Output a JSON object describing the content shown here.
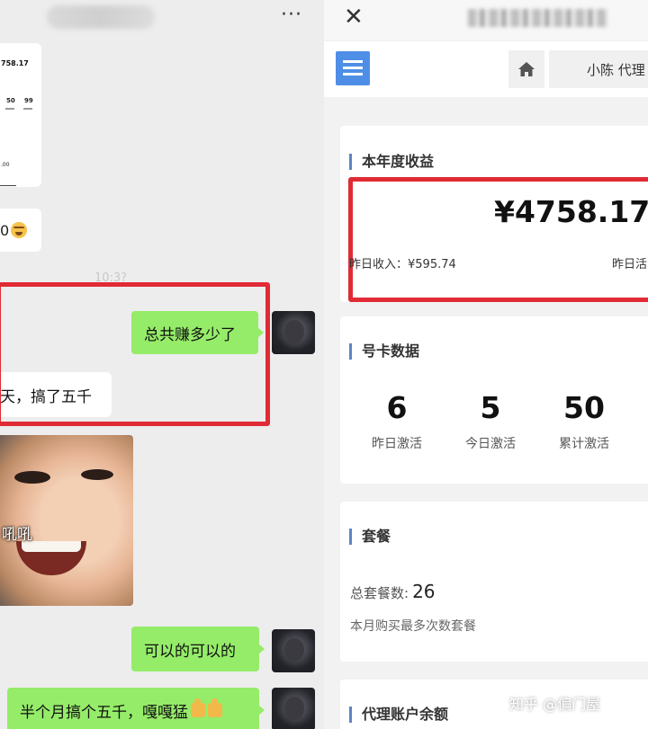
{
  "chat": {
    "header": {
      "more_label": "···"
    },
    "screenshot_thumb": {
      "amount": "758.17",
      "num_a": "50",
      "num_b": "99",
      "bottom": ".00"
    },
    "partial_bubble_text": "0",
    "time_ghost": "10:3?",
    "messages": [
      {
        "text": "总共赚多少了"
      },
      {
        "text": "天，搞了五千"
      },
      {
        "text": "可以的可以的"
      },
      {
        "text": "半个月搞个五千，嘎嘎猛"
      }
    ],
    "meme_caption": "吼吼"
  },
  "dashboard": {
    "close_label": "✕",
    "user_label": "小陈  代理",
    "yearly": {
      "title": "本年度收益",
      "amount": "¥4758.17",
      "yesterday_income": "昨日收入：¥595.74",
      "yesterday_right": "昨日活"
    },
    "cards_data": {
      "title": "号卡数据",
      "stats": [
        {
          "value": "6",
          "label": "昨日激活"
        },
        {
          "value": "5",
          "label": "今日激活"
        },
        {
          "value": "50",
          "label": "累计激活"
        }
      ]
    },
    "package": {
      "title": "套餐",
      "total_label": "总套餐数:",
      "total_value": "26",
      "desc": "本月购买最多次数套餐"
    },
    "balance": {
      "title": "代理账户余额"
    }
  },
  "watermark": "知乎 @偏门屋",
  "colors": {
    "bubble_green": "#95ec69",
    "highlight_red": "#e02b35",
    "menu_blue": "#4f8ee6"
  }
}
